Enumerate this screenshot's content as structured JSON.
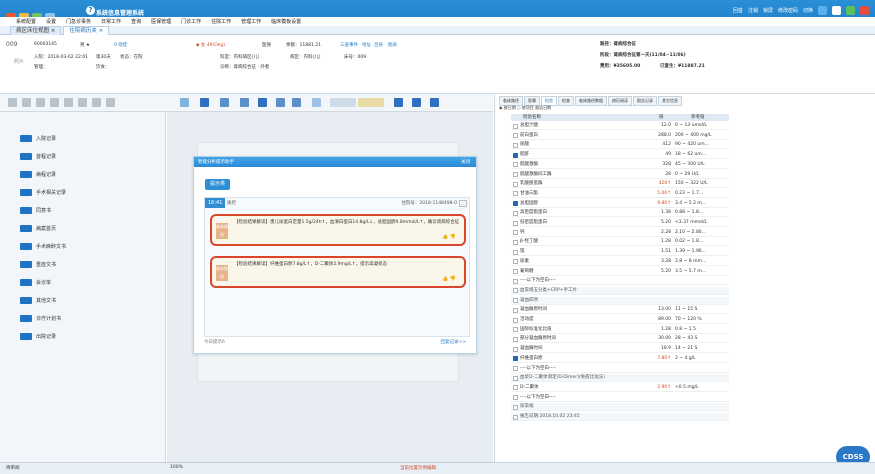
{
  "titlebar": {
    "app_title": "系统信息管理系统",
    "right_links": [
      "回首",
      "注销",
      "锁屏",
      "修改密码",
      "切换"
    ]
  },
  "menubar": [
    "系统配置",
    "设置",
    "门急诊事务",
    "日常工作",
    "查询",
    "医保管理",
    "门诊工作",
    "住院工作",
    "管理工作",
    "临床模板设置"
  ],
  "tabs": [
    {
      "label": "病区床位视图 ×"
    },
    {
      "label": "住院病历夹 ×"
    }
  ],
  "patient": {
    "no": "009",
    "mrn": "60003145",
    "gender": "男 ★",
    "visits": "0 现症",
    "alert": "◆ 女  49(Okg)",
    "insurance": "医保",
    "balance": "余额：11881.21",
    "links": [
      "三查事件",
      "地址",
      "吕县",
      "图表"
    ],
    "admit": "入院：2018-03-02 22:01",
    "days": "第30天",
    "status": "状态：在院",
    "dept": "科室：内科病区(儿)",
    "ward": "病区：内科(儿)",
    "bed_no": "床号：009",
    "photo": "照片",
    "doctor": "管理：",
    "diet": "饮食：",
    "nurse": "诊断：肾病综合征 · 外者",
    "path": "路径：肾病综合征",
    "stage": "阶段：肾病综合征第一天(11/04~11/06)",
    "cost": "费用：¥35605.00",
    "paid": "已复生：¥11887.21"
  },
  "leftnav": [
    "入院记录",
    "首程记录",
    "病程记录",
    "手术相关记录",
    "同意书",
    "病案首页",
    "手术麻醉文书",
    "重症文书",
    "会诊单",
    "其他文书",
    "诊疗计划书",
    "出院记录"
  ],
  "popup": {
    "title": "智能分析提示助手",
    "close": "关闭",
    "prompt_btn": "提示类",
    "time": "16:41",
    "source": "质控",
    "msg_time": "住院号：2018-1148498-0",
    "more": "...",
    "cards": [
      {
        "tag": "临床路径",
        "text": "【检验结果解读】患儿尿蛋白定量1.5g/24h↑，血清白蛋白14.8g/L↓，总胆固醇9.8mmol/L↑，确诊肾病综合征"
      },
      {
        "tag": "临床路径",
        "text": "【检验结果解读】纤维蛋白原7.8g/L↑，D-二聚体2.9mg/L↑，提示高凝状态"
      }
    ],
    "foot_left": "今日提示6",
    "foot_right": "回复记录>>"
  },
  "right": {
    "tabs": [
      "临床路径",
      "医嘱",
      "检验",
      "检查",
      "临床路径数据",
      "病历阅读",
      "报告记录",
      "其它信息"
    ],
    "filter": "◉ 按日期  ○ 按项目  报告日期",
    "headers": {
      "name": "检验名称",
      "value": "值",
      "range": "参考值"
    },
    "rows": [
      {
        "name": "总胆汁酸",
        "value": "12.0",
        "range": "0 ~ 13 umol/L",
        "on": false,
        "up": false
      },
      {
        "name": "前白蛋白",
        "value": "288.0",
        "range": "200 ~ 400 mg/L",
        "on": false,
        "up": false
      },
      {
        "name": "尿酸",
        "value": "412",
        "range": "90 ~ 420 um…",
        "on": false,
        "up": false
      },
      {
        "name": "肌酐",
        "value": "49",
        "range": "18 ~ 62 um…",
        "on": true,
        "up": false
      },
      {
        "name": "肌酸激酶",
        "value": "328",
        "range": "45 ~ 300 U/L",
        "on": false,
        "up": false
      },
      {
        "name": "肌酸激酶同工酶",
        "value": "28",
        "range": "0 ~ 29 U/L",
        "on": false,
        "up": false
      },
      {
        "name": "乳酸脱氢酶",
        "value": "420↑",
        "range": "150 ~ 322 U/L",
        "on": false,
        "up": true
      },
      {
        "name": "甘油三酯",
        "value": "5.00↑",
        "range": "0.23 ~ 1.7…",
        "on": false,
        "up": true
      },
      {
        "name": "总胆固醇",
        "value": "9.80↑",
        "range": "3.4 ~ 5.2 m…",
        "on": true,
        "up": true
      },
      {
        "name": "高密度脂蛋白",
        "value": "1.38",
        "range": "0.88 ~ 1.8…",
        "on": false,
        "up": false
      },
      {
        "name": "低密度脂蛋白",
        "value": "5.20",
        "range": "<3.37 mmol/L",
        "on": false,
        "up": false
      },
      {
        "name": "钙",
        "value": "2.28",
        "range": "2.10 ~ 2.80…",
        "on": false,
        "up": false
      },
      {
        "name": "β-羟丁酸",
        "value": "1.28",
        "range": "0.02 ~ 1.8…",
        "on": false,
        "up": false
      },
      {
        "name": "镁",
        "value": "1.51",
        "range": "1.39 ~ 1.96…",
        "on": false,
        "up": false
      },
      {
        "name": "尿素",
        "value": "3.28",
        "range": "2.8 ~ 8 mm…",
        "on": false,
        "up": false
      },
      {
        "name": "葡萄糖",
        "value": "5.20",
        "range": "3.5 ~ 5.7 m…",
        "on": false,
        "up": false
      },
      {
        "name": "----以下为空白----",
        "value": "",
        "range": "",
        "on": false,
        "up": false
      },
      {
        "name": "血常规五分类+CRP+手工片",
        "value": "",
        "range": "",
        "on": false,
        "up": false,
        "grp": true
      },
      {
        "name": "凝血四项",
        "value": "",
        "range": "",
        "on": false,
        "up": false,
        "grp": true
      },
      {
        "name": "凝血酶原时间",
        "value": "13.00",
        "range": "11 ~ 15 S",
        "on": false,
        "up": false
      },
      {
        "name": "活动度",
        "value": "89.00",
        "range": "70 ~ 120 %",
        "on": false,
        "up": false
      },
      {
        "name": "国际标准化比值",
        "value": "1.28",
        "range": "0.8 ~ 1.5",
        "on": false,
        "up": false
      },
      {
        "name": "部分凝血酶原时间",
        "value": "30.00",
        "range": "28 ~ 43 S",
        "on": false,
        "up": false
      },
      {
        "name": "凝血酶时间",
        "value": "18.9",
        "range": "14 ~ 21 S",
        "on": false,
        "up": false
      },
      {
        "name": "纤维蛋白原",
        "value": "7.80↑",
        "range": "2 ~ 4 g/L",
        "on": true,
        "up": true
      },
      {
        "name": "----以下为空白----",
        "value": "",
        "range": "",
        "on": false,
        "up": false
      },
      {
        "name": "血浆D-二聚体测定(D-Dimer)(免疫比浊法)",
        "value": "",
        "range": "",
        "on": false,
        "up": false,
        "grp": true
      },
      {
        "name": "D-二聚体",
        "value": "2.90↑",
        "range": "<0.5 mg/L",
        "on": false,
        "up": true
      },
      {
        "name": "----以下为空白----",
        "value": "",
        "range": "",
        "on": false,
        "up": false
      },
      {
        "name": "尿常规",
        "value": "",
        "range": "",
        "on": false,
        "up": false,
        "grp": true
      },
      {
        "name": "报告日期:2018.10.02 23:45",
        "value": "",
        "range": "",
        "on": false,
        "up": false,
        "grp": true
      }
    ]
  },
  "status": {
    "user": "待审阅",
    "zoom": "100%",
    "center": "当前位置示例编辑",
    "cdss": "CDSS"
  },
  "colors": {
    "brand": "#1f7bc2",
    "alert": "#d9462b"
  }
}
